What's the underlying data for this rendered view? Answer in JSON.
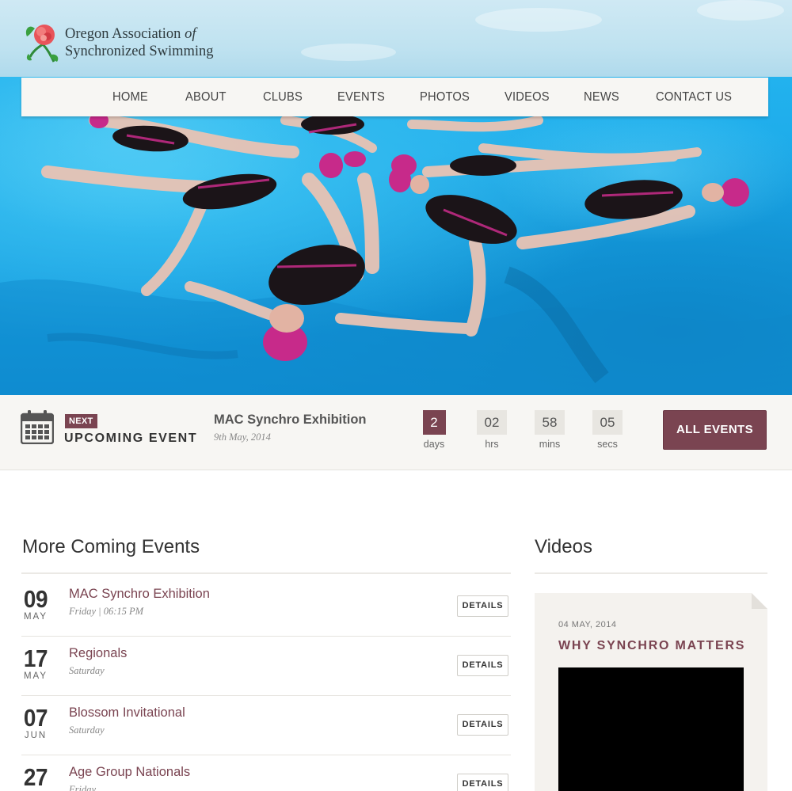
{
  "brand": {
    "line1": "Oregon Association",
    "line1_em": "of",
    "line2": "Synchronized Swimming",
    "logo_icon": "rose-logo-icon"
  },
  "nav": {
    "items": [
      {
        "label": "HOME"
      },
      {
        "label": "ABOUT"
      },
      {
        "label": "CLUBS"
      },
      {
        "label": "EVENTS"
      },
      {
        "label": "PHOTOS"
      },
      {
        "label": "VIDEOS"
      },
      {
        "label": "NEWS"
      },
      {
        "label": "CONTACT US"
      }
    ]
  },
  "hero": {
    "image": "synchronized-swimmers-star-formation-photo"
  },
  "upcoming": {
    "icon": "calendar-icon",
    "badge": "NEXT",
    "label": "UPCOMING EVENT",
    "title": "MAC Synchro Exhibition",
    "date": "9th May, 2014",
    "countdown": [
      {
        "value": "2",
        "unit": "days"
      },
      {
        "value": "02",
        "unit": "hrs"
      },
      {
        "value": "58",
        "unit": "mins"
      },
      {
        "value": "05",
        "unit": "secs"
      }
    ],
    "button": "ALL EVENTS"
  },
  "events": {
    "heading": "More Coming Events",
    "details_label": "DETAILS",
    "items": [
      {
        "day": "09",
        "month": "MAY",
        "name": "MAC Synchro Exhibition",
        "meta": "Friday | 06:15 PM"
      },
      {
        "day": "17",
        "month": "MAY",
        "name": "Regionals",
        "meta": "Saturday"
      },
      {
        "day": "07",
        "month": "JUN",
        "name": "Blossom Invitational",
        "meta": "Saturday"
      },
      {
        "day": "27",
        "month": "",
        "name": "Age Group Nationals",
        "meta": "Friday"
      }
    ]
  },
  "videos": {
    "heading": "Videos",
    "card": {
      "date": "04 MAY, 2014",
      "title": "WHY SYNCHRO MATTERS"
    }
  },
  "colors": {
    "accent": "#7a4451",
    "bar_bg": "#f7f6f3",
    "water": "#1aa6e6"
  }
}
